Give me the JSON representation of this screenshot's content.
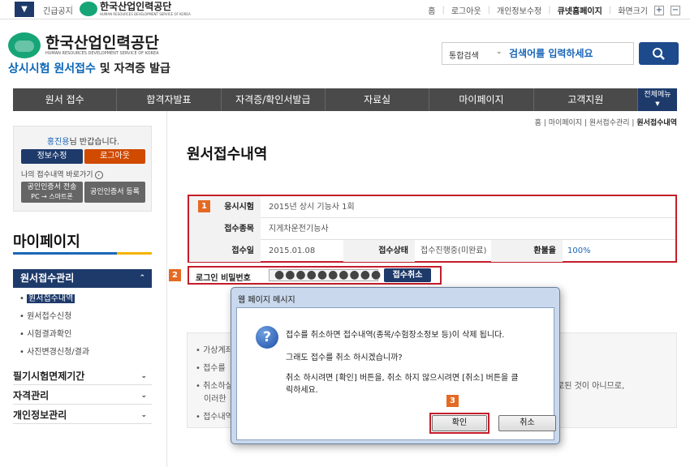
{
  "topbar": {
    "notice": "긴급공지",
    "sep": "|",
    "qnet_logo": "한국산업인력공단",
    "qnet_logo_sub": "HUMAN RESOURCES DEVELOPMENT SERVICE OF KOREA",
    "links": [
      "홈",
      "로그아웃",
      "개인정보수정",
      "큐넷홈페이지",
      "화면크기"
    ],
    "zoom_in": "+",
    "zoom_out": "−"
  },
  "header": {
    "logo_title": "한국산업인력공단",
    "logo_sub": "HUMAN RESOURCES DEVELOPMENT SERVICE OF KOREA",
    "site_title_blue": "상시시험 원서접수",
    "site_title_rest": " 및 자격증 발급"
  },
  "search": {
    "category": "통합검색",
    "placeholder": "검색어를 입력하세요"
  },
  "gnb": {
    "items": [
      "원서 접수",
      "합격자발표",
      "자격증/확인서발급",
      "자료실",
      "마이페이지",
      "고객지원"
    ],
    "all_menu_1": "전체메뉴",
    "all_menu_2": "▼"
  },
  "userbox": {
    "name": "홍진용",
    "greet_suffix": "님 반갑습니다.",
    "btn_info": "정보수정",
    "btn_logout": "로그아웃",
    "shortcut": "나의 접수내역 바로가기",
    "cert_send_1": "공인인증서 전송",
    "cert_send_2": "PC → 스마트폰",
    "cert_register": "공인인증서 등록"
  },
  "sidebar": {
    "title": "마이페이지",
    "active": "원서접수관리",
    "sub": [
      "원서접수내역",
      "원서접수신청",
      "시험결과확인",
      "사진변경신청/결과"
    ],
    "menus": [
      "필기시험면제기간",
      "자격관리",
      "개인정보관리"
    ]
  },
  "breadcrumb": {
    "home": "홈",
    "mypage": "마이페이지",
    "manage": "원서접수관리",
    "current": "원서접수내역"
  },
  "main": {
    "page_title": "원서접수내역",
    "badge1": "1",
    "badge2": "2",
    "badge3": "3",
    "rows": {
      "exam_label": "응시시험",
      "exam_value": "2015년 상시 기능사 1회",
      "field_label": "접수종목",
      "field_value": "지게차운전기능사",
      "date_label": "접수일",
      "date_value": "2015.01.08",
      "status_label": "접수상태",
      "status_value": "접수진행중(미완료)",
      "refund_label": "환불율",
      "refund_value": "100%"
    },
    "password_label": "로그인 비밀번호",
    "password_mask": "●●●●●●●●●●",
    "cancel_button": "접수취소",
    "notes": [
      "• 가상계좌",
      "• 접수를",
      "• 취소하실",
      "이러한",
      "• 접수내역"
    ],
    "note_right": "로된 것이 아니므로,"
  },
  "dialog": {
    "title": "웹 페이지 메시지",
    "line1": "접수를 취소하면 접수내역(종목/수험장소정보 등)이 삭제 됩니다.",
    "line2": "그래도 접수를 취소 하시겠습니까?",
    "line3": "취소 하시려면 [확인] 버튼을, 취소 하지 않으시려면 [취소] 버튼을 클",
    "line4": "릭하세요.",
    "ok": "확인",
    "cancel": "취소",
    "q": "?"
  },
  "colors": {
    "navy": "#1d3a6b",
    "highlight_red": "#c41d2a",
    "badge_orange": "#e46a24",
    "logout_orange": "#d04a00",
    "link_blue": "#1a66b7"
  }
}
